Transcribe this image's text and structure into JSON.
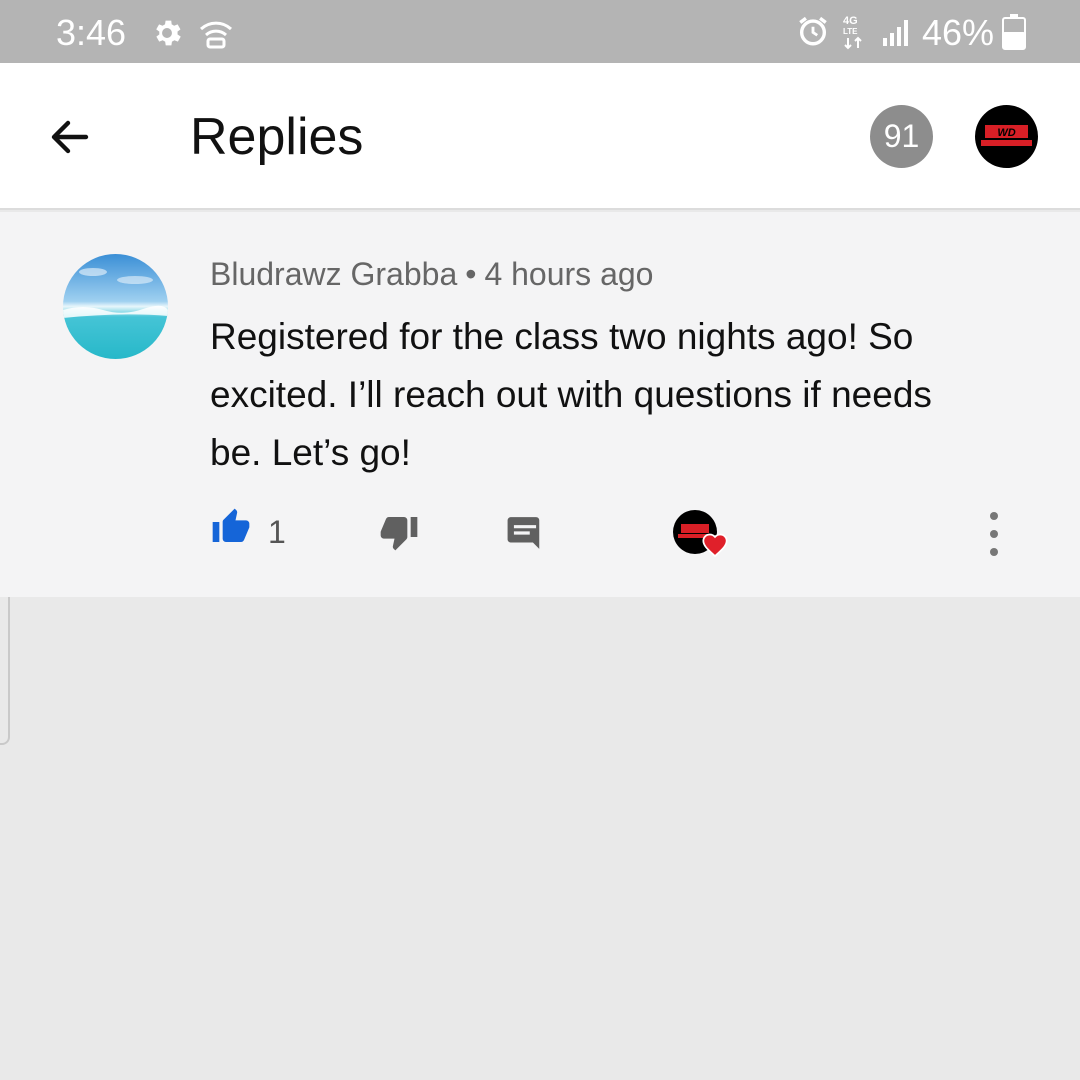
{
  "status_bar": {
    "time": "3:46",
    "battery": "46%",
    "icons": [
      "gear-icon",
      "wifi-icon",
      "alarm-icon",
      "4g-lte-icon",
      "signal-icon",
      "battery-icon"
    ]
  },
  "header": {
    "title": "Replies",
    "notification_count": "91",
    "back_icon": "arrow-left-icon",
    "account_logo_text": "WD"
  },
  "comment": {
    "author": "Bludrawz Grabba",
    "separator": "•",
    "time": "4 hours ago",
    "text": "Registered for the class two nights ago! So excited. I’ll reach out with questions if needs be. Let’s go!",
    "like_count": "1",
    "liked": true,
    "creator_heart": true
  },
  "colors": {
    "like_active": "#1565d8",
    "heart": "#e0202a",
    "status_bar_bg": "#b4b4b4",
    "panel_bg": "#f4f4f5",
    "page_bg": "#e9e9e9"
  }
}
